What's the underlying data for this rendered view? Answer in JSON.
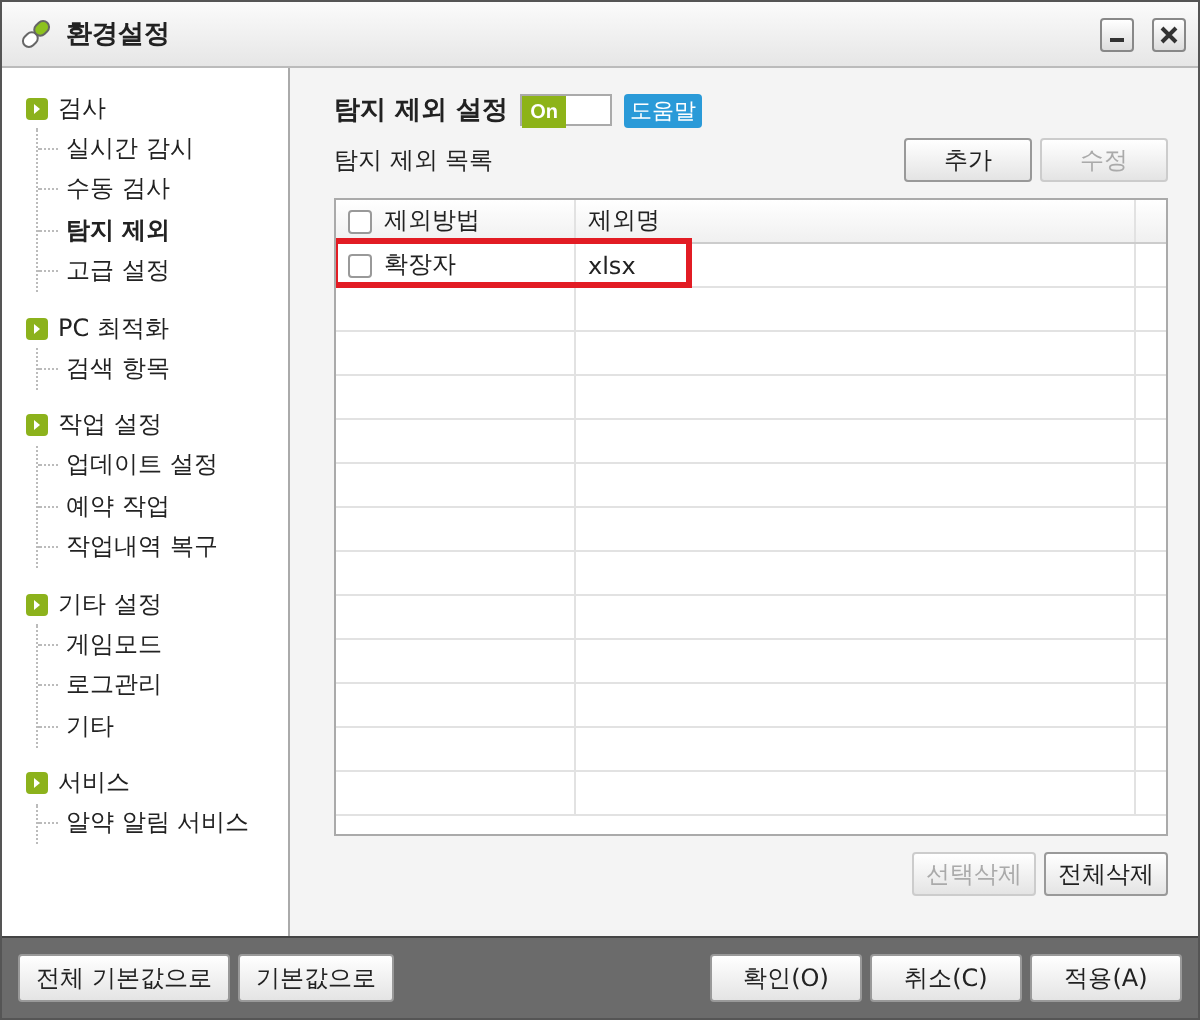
{
  "window": {
    "title": "환경설정"
  },
  "sidebar": {
    "groups": [
      {
        "label": "검사",
        "children": [
          {
            "label": "실시간 감시",
            "selected": false
          },
          {
            "label": "수동 검사",
            "selected": false
          },
          {
            "label": "탐지 제외",
            "selected": true
          },
          {
            "label": "고급 설정",
            "selected": false
          }
        ]
      },
      {
        "label": "PC 최적화",
        "children": [
          {
            "label": "검색 항목",
            "selected": false
          }
        ]
      },
      {
        "label": "작업 설정",
        "children": [
          {
            "label": "업데이트 설정",
            "selected": false
          },
          {
            "label": "예약 작업",
            "selected": false
          },
          {
            "label": "작업내역 복구",
            "selected": false
          }
        ]
      },
      {
        "label": "기타 설정",
        "children": [
          {
            "label": "게임모드",
            "selected": false
          },
          {
            "label": "로그관리",
            "selected": false
          },
          {
            "label": "기타",
            "selected": false
          }
        ]
      },
      {
        "label": "서비스",
        "children": [
          {
            "label": "알약 알림 서비스",
            "selected": false
          }
        ]
      }
    ]
  },
  "panel": {
    "title": "탐지 제외 설정",
    "toggle": {
      "label": "On",
      "on": true
    },
    "help": "도움말",
    "list_label": "탐지 제외 목록",
    "top_buttons": [
      {
        "label": "추가",
        "disabled": false
      },
      {
        "label": "수정",
        "disabled": true
      }
    ],
    "table": {
      "columns": [
        "제외방법",
        "제외명"
      ],
      "header_checked": false,
      "rows": [
        {
          "method": "확장자",
          "name": "xlsx",
          "checked": false,
          "highlighted": true
        }
      ]
    },
    "bottom_buttons": [
      {
        "label": "선택삭제",
        "disabled": true
      },
      {
        "label": "전체삭제",
        "disabled": false
      }
    ]
  },
  "footer": {
    "left_buttons": [
      "전체 기본값으로",
      "기본값으로"
    ],
    "right_buttons": [
      "확인(O)",
      "취소(C)",
      "적용(A)"
    ]
  }
}
